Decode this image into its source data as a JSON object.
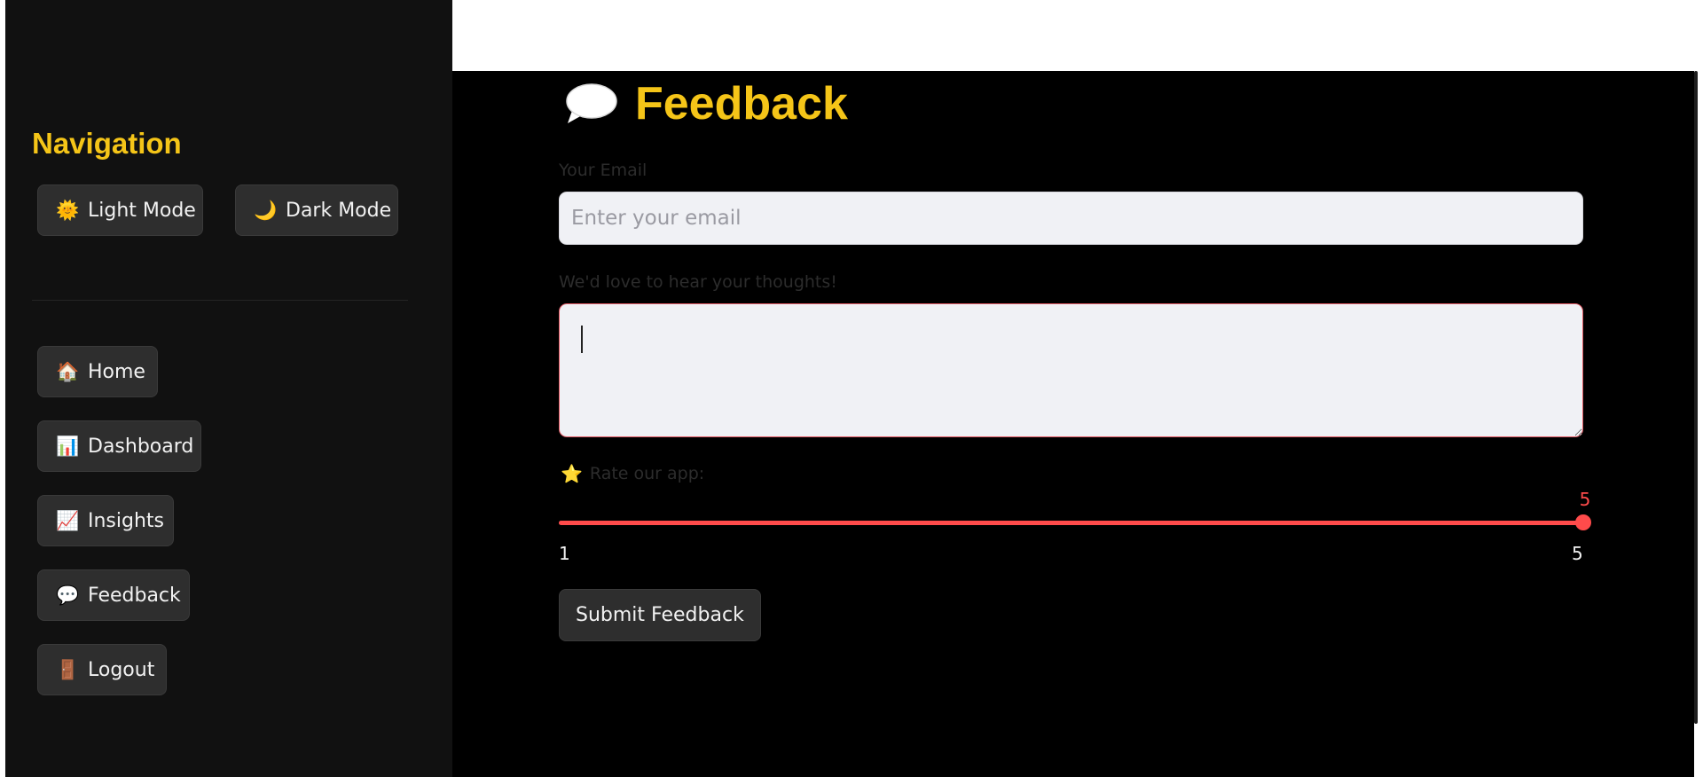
{
  "sidebar": {
    "title": "Navigation",
    "theme_buttons": [
      {
        "icon": "🌞",
        "label": "Light Mode"
      },
      {
        "icon": "🌙",
        "label": "Dark Mode"
      }
    ],
    "nav_items": [
      {
        "icon": "🏠",
        "label": "Home"
      },
      {
        "icon": "📊",
        "label": "Dashboard"
      },
      {
        "icon": "📈",
        "label": "Insights"
      },
      {
        "icon": "💬",
        "label": "Feedback"
      },
      {
        "icon": "🚪",
        "label": "Logout"
      }
    ]
  },
  "main": {
    "title": "Feedback",
    "title_icon": "speech-bubble-icon",
    "email": {
      "label": "Your Email",
      "placeholder": "Enter your email",
      "value": ""
    },
    "thoughts": {
      "label": "We'd love to hear your thoughts!",
      "value": ""
    },
    "rating": {
      "icon": "⭐",
      "label": "Rate our app:",
      "min": "1",
      "max": "5",
      "value": "5"
    },
    "submit_label": "Submit Feedback"
  },
  "colors": {
    "accent_yellow": "#f5c518",
    "slider_red": "#ff4b4b",
    "sidebar_bg": "#111111",
    "main_bg": "#000000",
    "button_bg": "#2e2e2e"
  }
}
